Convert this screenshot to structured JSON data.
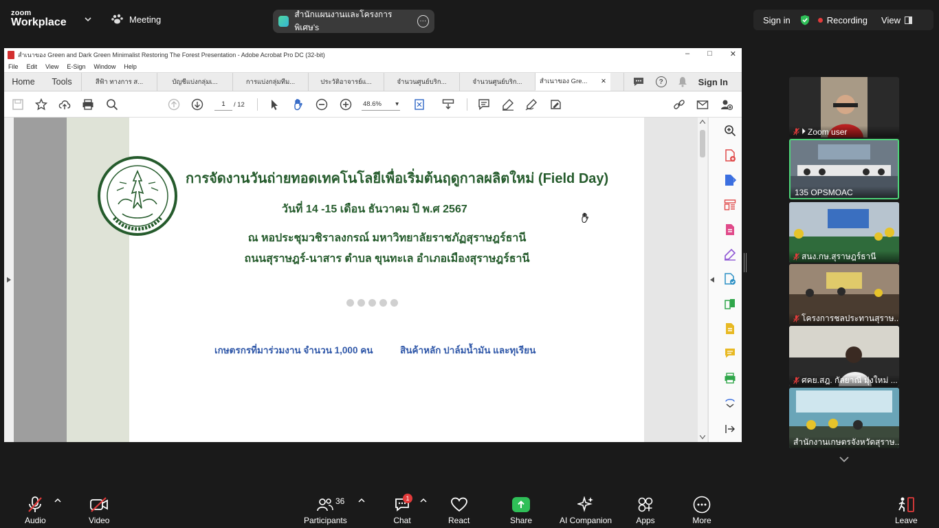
{
  "topbar": {
    "logo_line1": "zoom",
    "logo_line2": "Workplace",
    "meeting_label": "Meeting",
    "meeting_title": "สำนักแผนงานและโครงการพิเศษ's",
    "signin_label": "Sign in",
    "recording_label": "Recording",
    "view_label": "View"
  },
  "acrobat": {
    "window_title": "สำเนาของ Green and Dark Green Minimalist Restoring The Forest Presentation - Adobe Acrobat Pro DC (32-bit)",
    "menu": [
      "File",
      "Edit",
      "View",
      "E-Sign",
      "Window",
      "Help"
    ],
    "home_tab": "Home",
    "tools_tab": "Tools",
    "doc_tabs": [
      "สีฟ้า ทางการ ส...",
      "บัญชีแบ่งกลุ่มเ...",
      "การแบ่งกลุ่มทีม...",
      "ประวัติอาจารย์แ...",
      "จำนวนศูนย์บริก...",
      "จำนวนศูนย์บริก...",
      "สำเนาของ Gre..."
    ],
    "signin_tab": "Sign In",
    "page_current": "1",
    "page_total": "/ 12",
    "zoom": "48.6%"
  },
  "pdf": {
    "title": "การจัดงานวันถ่ายทอดเทคโนโลยีเพื่อเริ่มต้นฤดูกาลผลิตใหม่ (Field Day)",
    "date": "วันที่ 14 -15 เดือน ธันวาคม ปี พ.ศ 2567",
    "venue": "ณ หอประชุมวชิราลงกรณ์ มหาวิทยาลัยราชภัฏสุราษฎร์ธานี",
    "address": "ถนนสุราษฎร์-นาสาร ตำบล ขุนทะเล อำเภอเมืองสุราษฎร์ธานี",
    "farmers": "เกษตรกรที่มาร่วมงาน จำนวน 1,000 คน",
    "products": "สินค้าหลัก ปาล์มน้ำมัน และทุเรียน"
  },
  "participants_strip": [
    {
      "name": "Zoom user",
      "muted": true,
      "pinned": true
    },
    {
      "name": "135 OPSMOAC",
      "muted": false,
      "active": true
    },
    {
      "name": "สนง.กษ.สุราษฎร์ธานี",
      "muted": true
    },
    {
      "name": "โครงการชลประทานสุราษ...",
      "muted": true
    },
    {
      "name": "ศคย.สฎ. กัลยาณี มุ่งใหม่ ...",
      "muted": true
    },
    {
      "name": "สำนักงานเกษตรจังหวัดสุราษ...",
      "muted": false
    }
  ],
  "bottombar": {
    "audio": "Audio",
    "video": "Video",
    "participants": "Participants",
    "participants_count": "36",
    "chat": "Chat",
    "chat_badge": "1",
    "react": "React",
    "share": "Share",
    "ai": "AI Companion",
    "apps": "Apps",
    "more": "More",
    "leave": "Leave"
  },
  "colors": {
    "zoom_bg": "#1a1a1a",
    "pdf_green": "#255b2c",
    "pdf_blue": "#2f57a8",
    "share_green": "#2fbf58",
    "active_border": "#4fd67a",
    "recording_red": "#e23b3b"
  }
}
